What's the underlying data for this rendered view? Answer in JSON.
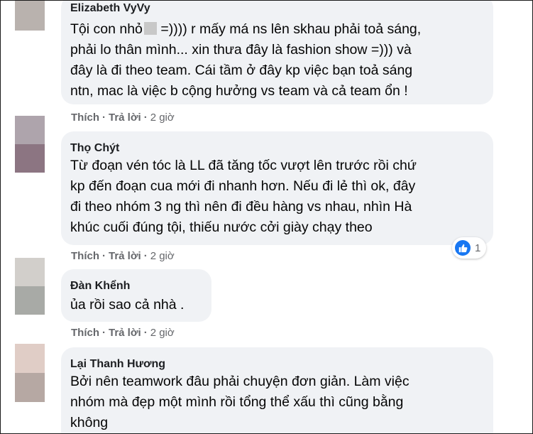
{
  "comments": [
    {
      "author": "Elizabeth VyVy",
      "lines": [
        "Tội con nhỏ",
        " =)))) r mấy má ns lên skhau phải toả sáng,",
        "phải lo thân mình... xin thưa đây là fashion show =))) và",
        "đây là đi theo team. Cái tầm ở đây kp việc bạn toả sáng",
        "ntn, mac là việc b cộng hưởng vs team và cả team ổn !"
      ],
      "actions": {
        "like": "Thích",
        "reply": "Trả lời",
        "time": "2 giờ"
      }
    },
    {
      "author": "Thọ Chýt",
      "lines": [
        "Từ đoạn vén tóc là LL đã tăng tốc vượt lên trước rồi chứ",
        "kp đến đoạn cua mới đi nhanh hơn. Nếu đi lẻ thì ok, đây",
        "đi theo nhóm 3 ng thì nên đi đều hàng vs nhau, nhìn Hà",
        "khúc cuối đúng tội, thiếu nước cởi giày chạy theo"
      ],
      "actions": {
        "like": "Thích",
        "reply": "Trả lời",
        "time": "2 giờ"
      },
      "reaction": {
        "icon": "like-icon",
        "count": "1"
      }
    },
    {
      "author": "Đàn Khểnh",
      "lines": [
        "ủa rồi sao cả nhà ."
      ],
      "actions": {
        "like": "Thích",
        "reply": "Trả lời",
        "time": "2 giờ"
      }
    },
    {
      "author": "Lại Thanh Hương",
      "lines": [
        "Bởi nên teamwork đâu phải chuyện đơn giản. Làm việc",
        "nhóm mà đẹp một mình rồi tổng thể xấu thì cũng bằng",
        "không"
      ]
    }
  ],
  "colors": {
    "bubble": "#f0f2f5",
    "meta": "#65676b",
    "text": "#050505",
    "like_blue": "#1877f2"
  }
}
